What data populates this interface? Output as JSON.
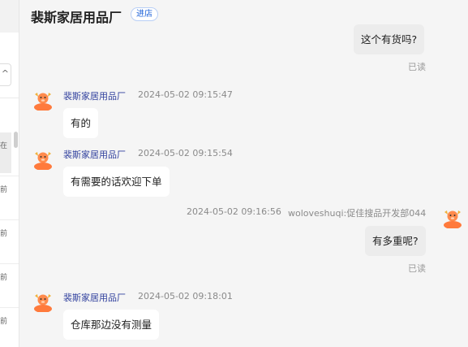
{
  "header": {
    "shop_name": "裴斯家居用品厂",
    "enter_label": "进店"
  },
  "sidebar_fragments": [
    "在",
    "前",
    "前",
    "前",
    "前"
  ],
  "messages": [
    {
      "from": "me",
      "text": "这个有货吗?",
      "status": "已读"
    },
    {
      "from": "shop",
      "sender": "裴斯家居用品厂",
      "time": "2024-05-02 09:15:47",
      "text": "有的"
    },
    {
      "from": "shop",
      "sender": "裴斯家居用品厂",
      "time": "2024-05-02 09:15:54",
      "text": "有需要的话欢迎下单"
    },
    {
      "from": "me",
      "time": "2024-05-02 09:16:56",
      "sender": "woloveshuqi:促佳搜品开发部044",
      "text": "有多重呢?",
      "status": "已读"
    },
    {
      "from": "shop",
      "sender": "裴斯家居用品厂",
      "time": "2024-05-02 09:18:01",
      "text": "仓库那边没有测量"
    }
  ]
}
